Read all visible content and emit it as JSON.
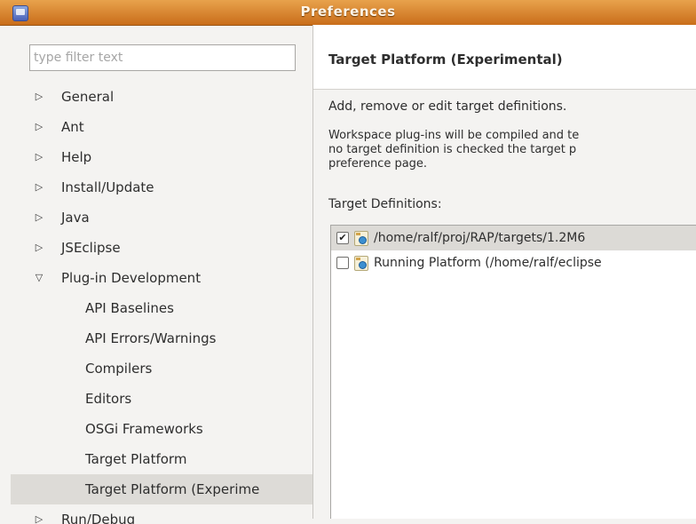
{
  "window": {
    "title": "Preferences"
  },
  "sidebar": {
    "filter_placeholder": "type filter text",
    "items": [
      {
        "label": "General",
        "level": 0,
        "state": "collapsed"
      },
      {
        "label": "Ant",
        "level": 0,
        "state": "collapsed"
      },
      {
        "label": "Help",
        "level": 0,
        "state": "collapsed"
      },
      {
        "label": "Install/Update",
        "level": 0,
        "state": "collapsed"
      },
      {
        "label": "Java",
        "level": 0,
        "state": "collapsed"
      },
      {
        "label": "JSEclipse",
        "level": 0,
        "state": "collapsed"
      },
      {
        "label": "Plug-in Development",
        "level": 0,
        "state": "expanded"
      },
      {
        "label": "API Baselines",
        "level": 1
      },
      {
        "label": "API Errors/Warnings",
        "level": 1
      },
      {
        "label": "Compilers",
        "level": 1
      },
      {
        "label": "Editors",
        "level": 1
      },
      {
        "label": "OSGi Frameworks",
        "level": 1
      },
      {
        "label": "Target Platform",
        "level": 1
      },
      {
        "label": "Target Platform (Experime",
        "level": 1,
        "selected": true
      },
      {
        "label": "Run/Debug",
        "level": 0,
        "state": "collapsed"
      }
    ]
  },
  "page": {
    "title": "Target Platform (Experimental)",
    "description": "Add, remove or edit target definitions.",
    "note_lines": [
      "Workspace plug-ins will be compiled and te",
      "no target definition is checked the target p",
      "preference page."
    ],
    "definitions_label": "Target Definitions:",
    "definitions": [
      {
        "label": "/home/ralf/proj/RAP/targets/1.2M6",
        "checked": true,
        "selected": true
      },
      {
        "label": "Running Platform (/home/ralf/eclipse",
        "checked": false,
        "selected": false
      }
    ]
  },
  "icons": {
    "expanded": "triangle-down",
    "collapsed": "triangle-right",
    "checked": "check-mark"
  },
  "colors": {
    "titlebar": "#d9822b",
    "selection": "#dddbd7",
    "background": "#f4f3f1"
  }
}
